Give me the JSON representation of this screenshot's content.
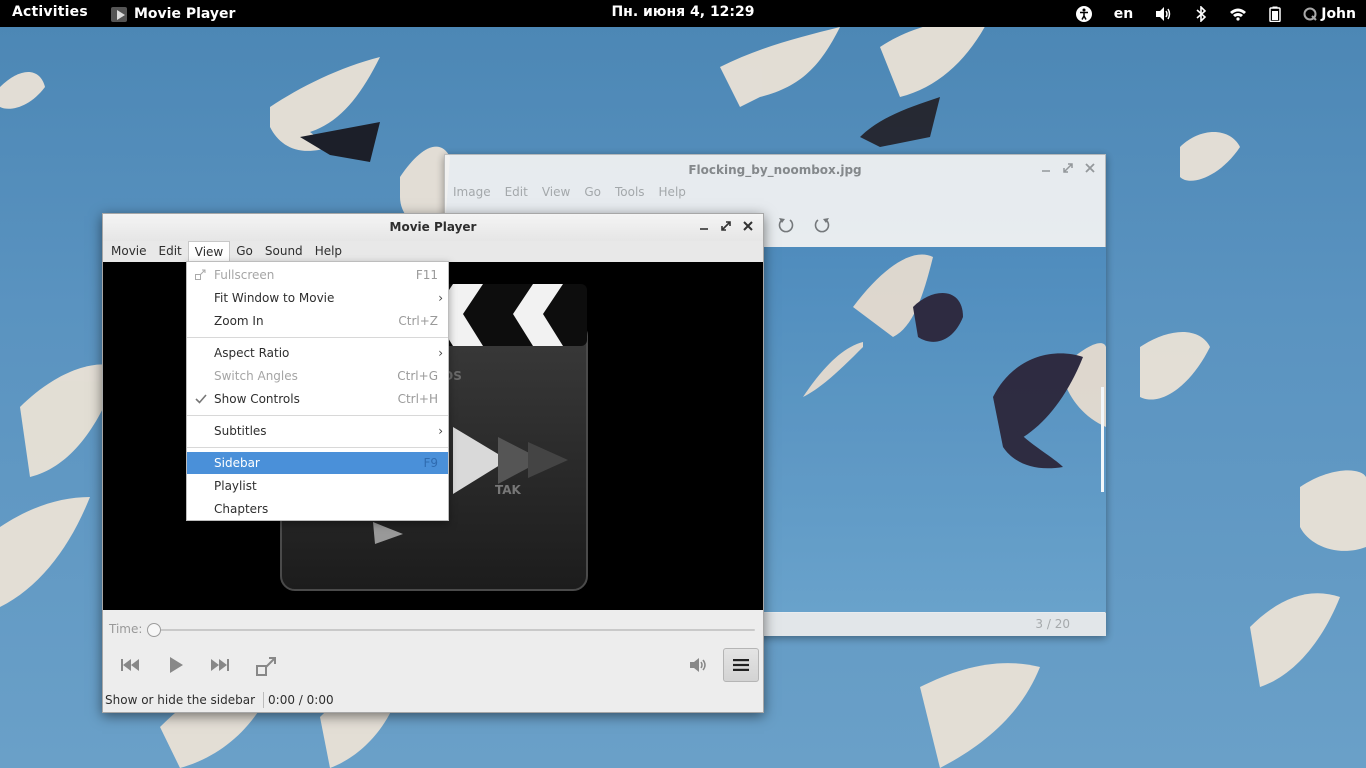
{
  "topbar": {
    "activities": "Activities",
    "app_name": "Movie Player",
    "clock": "Пн. июня  4, 12:29",
    "language": "en",
    "user": "John"
  },
  "image_viewer": {
    "title": "Flocking_by_noombox.jpg",
    "menu": [
      "Image",
      "Edit",
      "View",
      "Go",
      "Tools",
      "Help"
    ],
    "status_counter": "3 / 20"
  },
  "movie_player": {
    "title": "Movie Player",
    "menu": [
      "Movie",
      "Edit",
      "View",
      "Go",
      "Sound",
      "Help"
    ],
    "time_label": "Time:",
    "status_message": "Show or hide the sidebar",
    "time_display": "0:00 / 0:00"
  },
  "view_menu": {
    "items": [
      {
        "label": "Fullscreen",
        "accel": "F11"
      },
      {
        "label": "Fit Window to Movie",
        "accel": ""
      },
      {
        "label": "Zoom In",
        "accel": "Ctrl+Z"
      },
      {
        "label": "Aspect Ratio",
        "accel": ""
      },
      {
        "label": "Switch Angles",
        "accel": "Ctrl+G"
      },
      {
        "label": "Show Controls",
        "accel": "Ctrl+H"
      },
      {
        "label": "Subtitles",
        "accel": ""
      },
      {
        "label": "Sidebar",
        "accel": "F9"
      },
      {
        "label": "Playlist",
        "accel": ""
      },
      {
        "label": "Chapters",
        "accel": ""
      }
    ]
  },
  "colors": {
    "highlight": "#4a90d9",
    "topbar": "#000000",
    "sky": "#5a93c0"
  }
}
